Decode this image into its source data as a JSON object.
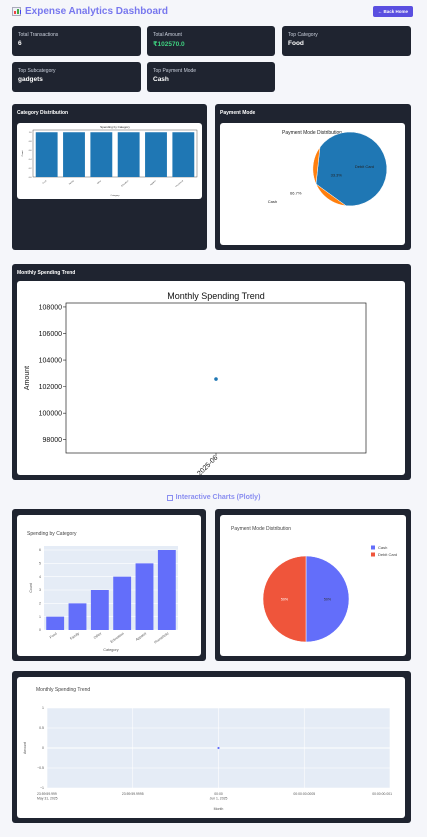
{
  "header": {
    "title": "Expense Analytics Dashboard",
    "back_label": "← Back Home",
    "icon": "bar-chart-icon"
  },
  "stats": [
    {
      "label": "Total Transactions",
      "value": "6"
    },
    {
      "label": "Total Amount",
      "value": "₹102570.0"
    },
    {
      "label": "Top Category",
      "value": "Food"
    },
    {
      "label": "Top Subcategory",
      "value": "gadgets"
    },
    {
      "label": "Top Payment Mode",
      "value": "Cash"
    }
  ],
  "panels": {
    "category": "Category Distribution",
    "payment": "Payment Mode",
    "monthly": "Monthly Spending Trend"
  },
  "interactive_heading": "Interactive Charts (Plotly)",
  "colors": {
    "accent": "#5a4fe0",
    "dark_card": "#1f2430",
    "green": "#3ed07f",
    "mpl_blue": "#1f77b4",
    "mpl_orange": "#ff7f0e",
    "plotly_blue": "#636efa",
    "plotly_red": "#ef553b"
  },
  "chart_data": [
    {
      "id": "mpl_category",
      "type": "bar",
      "title": "Spending by Category",
      "xlabel": "Category",
      "ylabel": "Count",
      "categories": [
        "Food",
        "Family",
        "Other",
        "Education",
        "Apparel",
        "Household"
      ],
      "values": [
        1,
        1,
        1,
        1,
        1,
        1
      ],
      "ylim": [
        0,
        1.05
      ],
      "yticks": [
        "0.0",
        "0.2",
        "0.4",
        "0.6",
        "0.8",
        "1.0"
      ]
    },
    {
      "id": "mpl_payment",
      "type": "pie",
      "title": "Payment Mode Distribution",
      "labels": [
        "Cash",
        "Debit Card"
      ],
      "values": [
        66.7,
        33.3
      ],
      "pct_labels": [
        "66.7%",
        "33.3%"
      ]
    },
    {
      "id": "mpl_monthly",
      "type": "scatter",
      "title": "Monthly Spending Trend",
      "ylabel": "Amount",
      "x": [
        "2025-06"
      ],
      "y": [
        102570
      ],
      "ylim": [
        97000,
        108300
      ],
      "yticks": [
        "98000",
        "100000",
        "102000",
        "104000",
        "106000",
        "108000"
      ]
    },
    {
      "id": "plotly_category",
      "type": "bar",
      "title": "Spending by Category",
      "xlabel": "Category",
      "ylabel": "Count",
      "categories": [
        "Food",
        "Family",
        "Other",
        "Education",
        "Apparel",
        "Household"
      ],
      "values": [
        1,
        2,
        3,
        4,
        5,
        6
      ],
      "ylim": [
        0,
        6.3
      ],
      "yticks": [
        "0",
        "1",
        "2",
        "3",
        "4",
        "5",
        "6"
      ]
    },
    {
      "id": "plotly_payment",
      "type": "pie",
      "title": "Payment Mode Distribution",
      "labels": [
        "Cash",
        "Debit Card"
      ],
      "values": [
        50,
        50
      ],
      "pct_labels": [
        "50%",
        "50%"
      ]
    },
    {
      "id": "plotly_monthly",
      "type": "scatter",
      "title": "Monthly Spending Trend",
      "xlabel": "Month",
      "ylabel": "Amount",
      "y": [
        0
      ],
      "ylim": [
        -1,
        1
      ],
      "yticks": [
        "−1",
        "−0.5",
        "0",
        "0.5",
        "1"
      ],
      "xticks": [
        "23:59:59.999\nMay 31, 2025",
        "23:59:59.9995",
        "00:00\nJun 1, 2025",
        "00:00:00.0005",
        "00:00:00.001"
      ]
    }
  ]
}
